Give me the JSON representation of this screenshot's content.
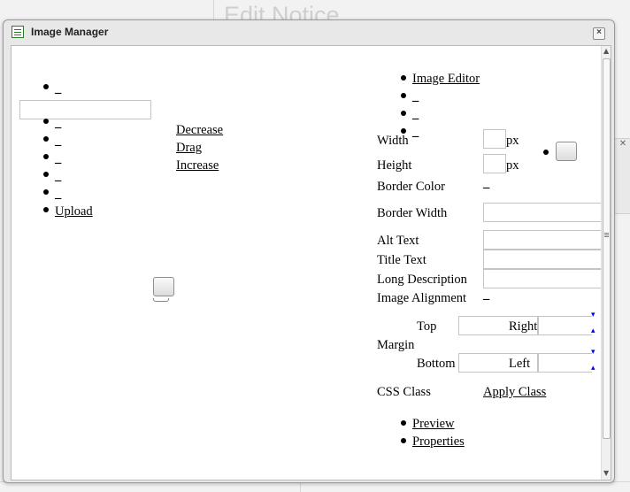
{
  "background": {
    "page_title": "Edit Notice"
  },
  "dialog": {
    "title": "Image Manager",
    "close_label": "×"
  },
  "left_panel": {
    "list_top_item": "_",
    "path_value": "",
    "list_items": [
      "_",
      "_",
      "_",
      "_",
      "_"
    ],
    "upload_label": "Upload",
    "zoom": {
      "decrease_label": "Decrease",
      "drag_label": "Drag",
      "increase_label": "Increase"
    }
  },
  "right_panel": {
    "tabs": {
      "image_editor_label": "Image Editor",
      "other_tabs": [
        "_",
        "_",
        "_"
      ]
    },
    "properties": {
      "width_label": "Width",
      "width_value": "",
      "width_unit": "px",
      "height_label": "Height",
      "height_value": "",
      "height_unit": "px",
      "border_color_label": "Border Color",
      "border_color_link": "_",
      "border_width_label": "Border Width",
      "border_width_value": "",
      "alt_text_label": "Alt Text",
      "alt_text_value": "",
      "title_text_label": "Title Text",
      "title_text_value": "",
      "long_description_label": "Long Description",
      "long_description_value": "",
      "image_alignment_label": "Image Alignment",
      "image_alignment_link": "_"
    },
    "margin": {
      "label": "Margin",
      "top_label": "Top",
      "right_label": "Right",
      "bottom_label": "Bottom",
      "left_label": "Left"
    },
    "css_class": {
      "label": "CSS Class",
      "apply_label": "Apply Class"
    },
    "footer_links": {
      "preview_label": "Preview",
      "properties_label": "Properties"
    }
  },
  "colors": {
    "link": "#0000ee",
    "dialog_bg": "#e8e8e8",
    "content_bg": "#ffffff"
  }
}
